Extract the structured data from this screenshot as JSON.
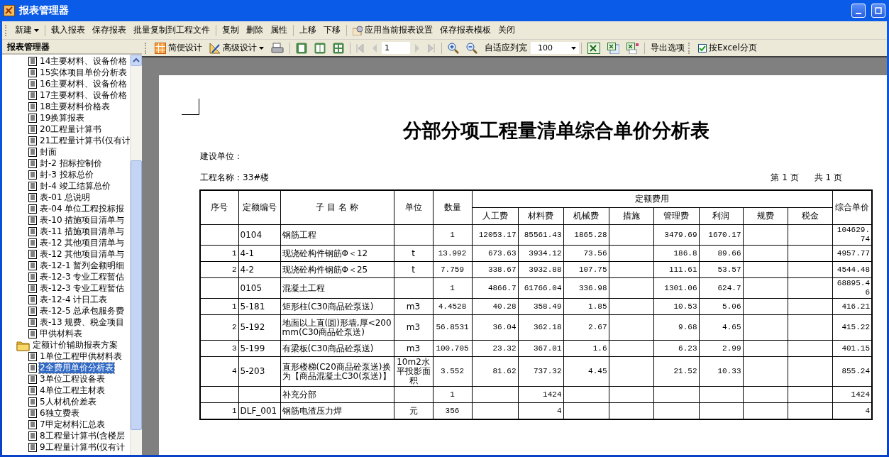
{
  "window": {
    "title": "报表管理器"
  },
  "toolbar": [
    {
      "kind": "menu-button",
      "label": "新建"
    },
    {
      "kind": "separator"
    },
    {
      "kind": "button",
      "label": "载入报表"
    },
    {
      "kind": "button",
      "label": "保存报表"
    },
    {
      "kind": "button",
      "label": "批量复制到工程文件"
    },
    {
      "kind": "separator"
    },
    {
      "kind": "button",
      "label": "复制"
    },
    {
      "kind": "button",
      "label": "删除"
    },
    {
      "kind": "button",
      "label": "属性"
    },
    {
      "kind": "separator"
    },
    {
      "kind": "button",
      "label": "上移"
    },
    {
      "kind": "button",
      "label": "下移"
    },
    {
      "kind": "separator"
    },
    {
      "kind": "icon-button",
      "label": "应用当前报表设置"
    },
    {
      "kind": "button",
      "label": "保存报表模板"
    },
    {
      "kind": "button",
      "label": "关闭"
    }
  ],
  "sidebar": {
    "title": "报表管理器",
    "items": [
      {
        "kind": "folder",
        "children": [
          {
            "label": "14主要材料、设备价格",
            "selected": false
          },
          {
            "label": "15实体项目单价分析表",
            "selected": false
          },
          {
            "label": "16主要材料、设备价格",
            "selected": false
          },
          {
            "label": "17主要材料、设备价格",
            "selected": false
          },
          {
            "label": "18主要材料价格表",
            "selected": false
          },
          {
            "label": "19换算报表",
            "selected": false
          },
          {
            "label": "20工程量计算书",
            "selected": false
          },
          {
            "label": "21工程量计算书(仅有计",
            "selected": false
          },
          {
            "label": "封面",
            "selected": false
          },
          {
            "label": "封-2 招标控制价",
            "selected": false
          },
          {
            "label": "封-3 投标总价",
            "selected": false
          },
          {
            "label": "封-4 竣工结算总价",
            "selected": false
          },
          {
            "label": "表-01 总说明",
            "selected": false
          },
          {
            "label": "表-04 单位工程投标报",
            "selected": false
          },
          {
            "label": "表-10 措施项目清单与",
            "selected": false
          },
          {
            "label": "表-11 措施项目清单与",
            "selected": false
          },
          {
            "label": "表-12 其他项目清单与",
            "selected": false
          },
          {
            "label": "表-12 其他项目清单与",
            "selected": false
          },
          {
            "label": "表-12-1 暂列金额明细",
            "selected": false
          },
          {
            "label": "表-12-3 专业工程暂估",
            "selected": false
          },
          {
            "label": "表-12-3 专业工程暂估",
            "selected": false
          },
          {
            "label": "表-12-4 计日工表",
            "selected": false
          },
          {
            "label": "表-12-5 总承包服务费",
            "selected": false
          },
          {
            "label": "表-13 规费、税金项目",
            "selected": false
          },
          {
            "label": "甲供材料表",
            "selected": false
          }
        ]
      },
      {
        "kind": "folder",
        "label": "定额计价辅助报表方案",
        "children": [
          {
            "label": "1单位工程甲供材料表",
            "selected": false
          },
          {
            "label": "2全费用单价分析表",
            "selected": true
          },
          {
            "label": "3单位工程设备表",
            "selected": false
          },
          {
            "label": "4单位工程主材表",
            "selected": false
          },
          {
            "label": "5人材机价差表",
            "selected": false
          },
          {
            "label": "6独立费表",
            "selected": false
          },
          {
            "label": "7甲定材料汇总表",
            "selected": false
          },
          {
            "label": "8工程量计算书(含楼层",
            "selected": false
          },
          {
            "label": "9工程量计算书(仅有计",
            "selected": false
          }
        ]
      }
    ]
  },
  "viewer_toolbar": {
    "simple_design": "简便设计",
    "advanced_design": "高级设计",
    "page": "1",
    "fit_columns": "自适应列宽",
    "zoom": "100",
    "export_options": "导出选项",
    "excel_paging": {
      "label": "按Excel分页",
      "checked": true
    }
  },
  "report": {
    "title": "分部分项工程量清单综合单价分析表",
    "builder": "建设单位：",
    "project": "工程名称：33#楼",
    "page": "第 1 页",
    "total_pages": "共 1 页",
    "table": {
      "columns": [
        {
          "label": "序号"
        },
        {
          "label": "定额编号"
        },
        {
          "label": "子 目 名 称"
        },
        {
          "label": "单位"
        },
        {
          "label": "数量"
        },
        {
          "label": "定额费用",
          "colspan": 8,
          "children": [
            {
              "label": "人工费"
            },
            {
              "label": "材料费"
            },
            {
              "label": "机械费"
            },
            {
              "label": "措施"
            },
            {
              "label": "管理费"
            },
            {
              "label": "利润"
            },
            {
              "label": "规费"
            },
            {
              "label": "税金"
            }
          ]
        },
        {
          "label": "综合单价"
        }
      ],
      "rows": [
        [
          null,
          "0104",
          "钢筋工程",
          null,
          "1",
          "12053.17",
          "85561.43",
          "1865.28",
          null,
          "3479.69",
          "1670.17",
          null,
          null,
          "104629.74"
        ],
        [
          "1",
          "4-1",
          "现浇砼构件钢筋Φ＜12",
          "t",
          "13.992",
          "673.63",
          "3934.12",
          "73.56",
          null,
          "186.8",
          "89.66",
          null,
          null,
          "4957.77"
        ],
        [
          "2",
          "4-2",
          "现浇砼构件钢筋Φ＜25",
          "t",
          "7.759",
          "338.67",
          "3932.88",
          "107.75",
          null,
          "111.61",
          "53.57",
          null,
          null,
          "4544.48"
        ],
        [
          null,
          "0105",
          "混凝土工程",
          null,
          "1",
          "4866.7",
          "61766.04",
          "336.98",
          null,
          "1301.06",
          "624.7",
          null,
          null,
          "68895.46"
        ],
        [
          "1",
          "5-181",
          "矩形柱(C30商品砼泵送)",
          "m3",
          "4.4528",
          "40.28",
          "358.49",
          "1.85",
          null,
          "10.53",
          "5.06",
          null,
          null,
          "416.21"
        ],
        [
          "2",
          "5-192",
          "地面以上直(圆)形墙,厚<200mm(C30商品砼泵送)",
          "m3",
          "56.8531",
          "36.04",
          "362.18",
          "2.67",
          null,
          "9.68",
          "4.65",
          null,
          null,
          "415.22"
        ],
        [
          "3",
          "5-199",
          "有梁板(C30商品砼泵送)",
          "m3",
          "100.705",
          "23.32",
          "367.01",
          "1.6",
          null,
          "6.23",
          "2.99",
          null,
          null,
          "401.15"
        ],
        [
          "4",
          "5-203",
          "直形楼梯(C20商品砼泵送)换为【商品混凝土C30(泵送)】",
          "10m2水平投影面积",
          "3.552",
          "81.62",
          "737.32",
          "4.45",
          null,
          "21.52",
          "10.33",
          null,
          null,
          "855.24"
        ],
        [
          null,
          null,
          "补充分部",
          null,
          "1",
          null,
          "1424",
          null,
          null,
          null,
          null,
          null,
          null,
          "1424"
        ],
        [
          "1",
          "DLF_001",
          "钢筋电渣压力焊",
          "元",
          "356",
          null,
          "4",
          null,
          null,
          null,
          null,
          null,
          null,
          "4"
        ]
      ]
    }
  }
}
